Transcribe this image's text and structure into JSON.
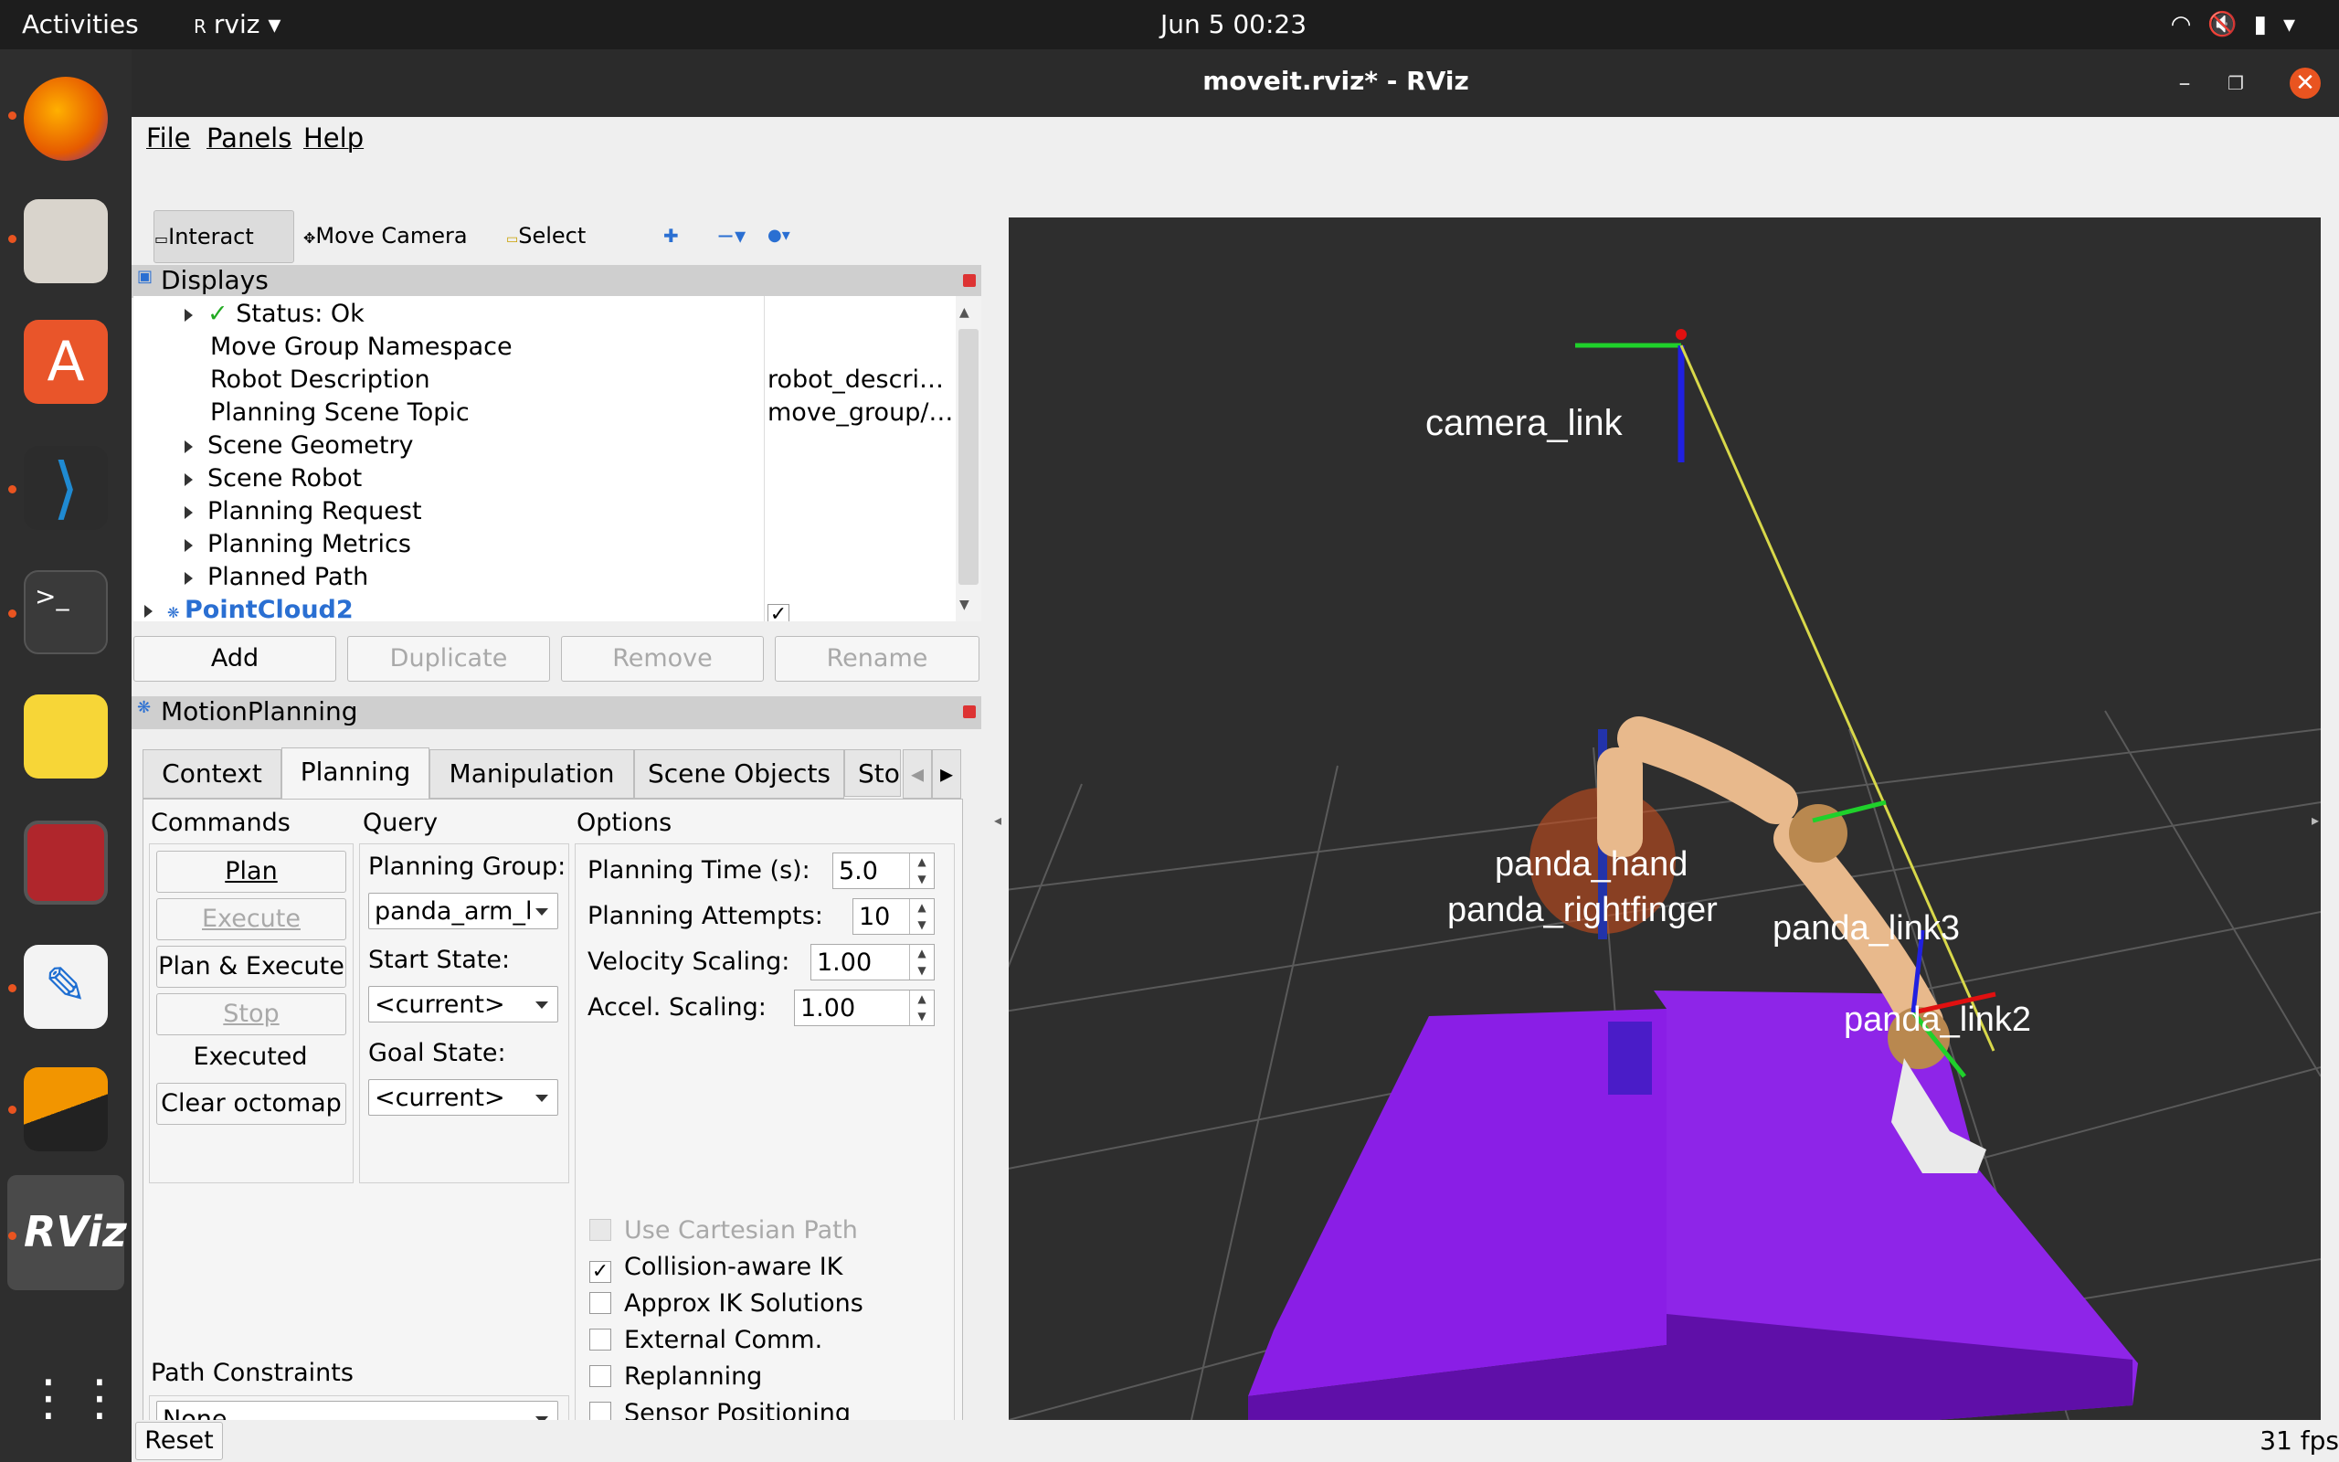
{
  "topbar": {
    "activities": "Activities",
    "app_name": "rviz",
    "clock": "Jun 5  00:23"
  },
  "window": {
    "title": "moveit.rviz* - RViz"
  },
  "menu": {
    "file": "File",
    "panels": "Panels",
    "help": "Help"
  },
  "toolbar": {
    "interact": "Interact",
    "move_camera": "Move Camera",
    "select": "Select"
  },
  "displays": {
    "title": "Displays",
    "rows": [
      {
        "label": "Status: Ok",
        "value": ""
      },
      {
        "label": "Move Group Namespace",
        "value": ""
      },
      {
        "label": "Robot Description",
        "value": "robot_descri…"
      },
      {
        "label": "Planning Scene Topic",
        "value": "move_group/…"
      },
      {
        "label": "Scene Geometry",
        "value": ""
      },
      {
        "label": "Scene Robot",
        "value": ""
      },
      {
        "label": "Planning Request",
        "value": ""
      },
      {
        "label": "Planning Metrics",
        "value": ""
      },
      {
        "label": "Planned Path",
        "value": ""
      },
      {
        "label": "PointCloud2",
        "value": ""
      }
    ],
    "buttons": {
      "add": "Add",
      "duplicate": "Duplicate",
      "remove": "Remove",
      "rename": "Rename"
    }
  },
  "motion_planning": {
    "title": "MotionPlanning",
    "tabs": [
      "Context",
      "Planning",
      "Manipulation",
      "Scene Objects",
      "Sto"
    ],
    "commands": {
      "heading": "Commands",
      "plan": "Plan",
      "execute": "Execute",
      "plan_execute": "Plan & Execute",
      "stop": "Stop",
      "status": "Executed",
      "clear_octomap": "Clear octomap"
    },
    "query": {
      "heading": "Query",
      "planning_group_label": "Planning Group:",
      "planning_group_value": "panda_arm_l",
      "start_state_label": "Start State:",
      "start_state_value": "<current>",
      "goal_state_label": "Goal State:",
      "goal_state_value": "<current>"
    },
    "options": {
      "heading": "Options",
      "planning_time_label": "Planning Time (s):",
      "planning_time_value": "5.0",
      "planning_attempts_label": "Planning Attempts:",
      "planning_attempts_value": "10",
      "velocity_scaling_label": "Velocity Scaling:",
      "velocity_scaling_value": "1.00",
      "accel_scaling_label": "Accel. Scaling:",
      "accel_scaling_value": "1.00",
      "checks": [
        {
          "label": "Use Cartesian Path",
          "checked": false,
          "enabled": false
        },
        {
          "label": "Collision-aware IK",
          "checked": true,
          "enabled": true
        },
        {
          "label": "Approx IK Solutions",
          "checked": false,
          "enabled": true
        },
        {
          "label": "External Comm.",
          "checked": false,
          "enabled": true
        },
        {
          "label": "Replanning",
          "checked": false,
          "enabled": true
        },
        {
          "label": "Sensor Positioning",
          "checked": false,
          "enabled": true
        }
      ]
    },
    "path_constraints": {
      "label": "Path Constraints",
      "value": "None"
    }
  },
  "viewport": {
    "labels": {
      "camera_link": "camera_link",
      "link3": "panda_link3",
      "link2": "panda_link2",
      "finger": "panda_rightfinger",
      "hand": "panda_hand"
    }
  },
  "statusbar": {
    "reset": "Reset",
    "fps": "31 fps"
  },
  "colors": {
    "accent": "#e95420",
    "octomap": "#8a1ee6",
    "robot": "#e8b98c"
  }
}
